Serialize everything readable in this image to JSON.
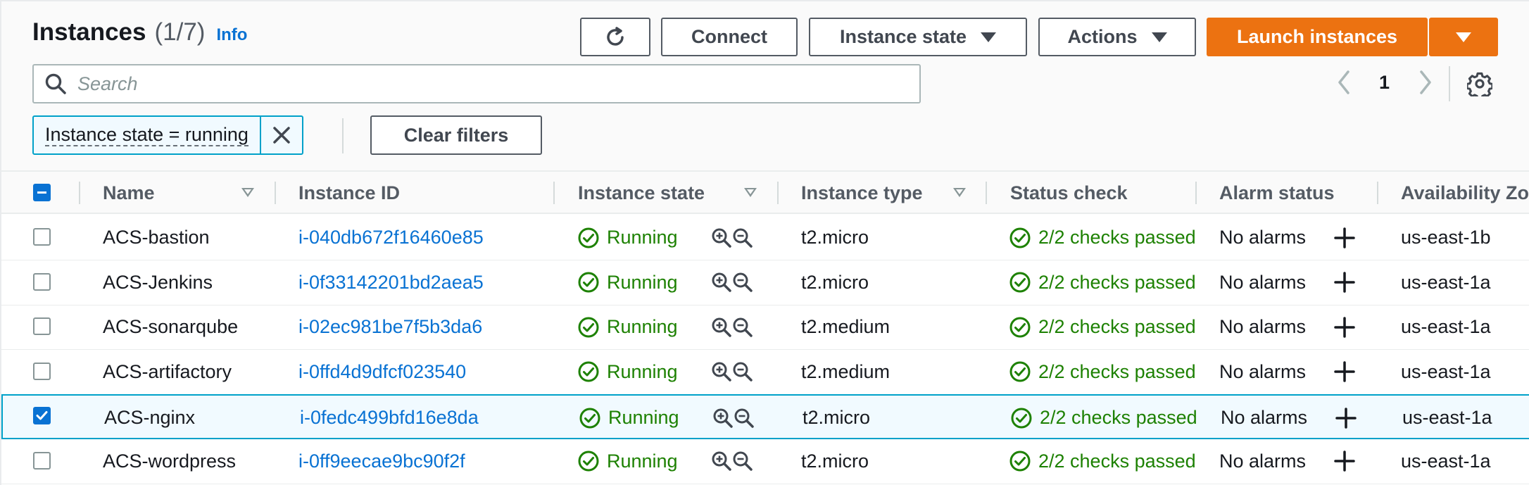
{
  "header": {
    "title": "Instances",
    "count": "(1/7)",
    "info": "Info"
  },
  "toolbar": {
    "connect": "Connect",
    "instance_state": "Instance state",
    "actions": "Actions",
    "launch": "Launch instances"
  },
  "search": {
    "placeholder": "Search",
    "value": ""
  },
  "pagination": {
    "page": "1"
  },
  "filter": {
    "chip_label": "Instance state = running",
    "clear": "Clear filters"
  },
  "table": {
    "columns": {
      "name": "Name",
      "instance_id": "Instance ID",
      "instance_state": "Instance state",
      "instance_type": "Instance type",
      "status_check": "Status check",
      "alarm_status": "Alarm status",
      "availability_zone": "Availability Zo"
    },
    "rows": [
      {
        "name": "ACS-bastion",
        "id": "i-040db672f16460e85",
        "state": "Running",
        "type": "t2.micro",
        "check": "2/2 checks passed",
        "alarm": "No alarms",
        "az": "us-east-1b",
        "selected": false
      },
      {
        "name": "ACS-Jenkins",
        "id": "i-0f33142201bd2aea5",
        "state": "Running",
        "type": "t2.micro",
        "check": "2/2 checks passed",
        "alarm": "No alarms",
        "az": "us-east-1a",
        "selected": false
      },
      {
        "name": "ACS-sonarqube",
        "id": "i-02ec981be7f5b3da6",
        "state": "Running",
        "type": "t2.medium",
        "check": "2/2 checks passed",
        "alarm": "No alarms",
        "az": "us-east-1a",
        "selected": false
      },
      {
        "name": "ACS-artifactory",
        "id": "i-0ffd4d9dfcf023540",
        "state": "Running",
        "type": "t2.medium",
        "check": "2/2 checks passed",
        "alarm": "No alarms",
        "az": "us-east-1a",
        "selected": false
      },
      {
        "name": "ACS-nginx",
        "id": "i-0fedc499bfd16e8da",
        "state": "Running",
        "type": "t2.micro",
        "check": "2/2 checks passed",
        "alarm": "No alarms",
        "az": "us-east-1a",
        "selected": true
      },
      {
        "name": "ACS-wordpress",
        "id": "i-0ff9eecae9bc90f2f",
        "state": "Running",
        "type": "t2.micro",
        "check": "2/2 checks passed",
        "alarm": "No alarms",
        "az": "us-east-1a",
        "selected": false
      }
    ]
  },
  "colors": {
    "primary": "#ec7211",
    "link": "#0972d3",
    "success": "#1d8102",
    "selected_border": "#00a1c9"
  }
}
